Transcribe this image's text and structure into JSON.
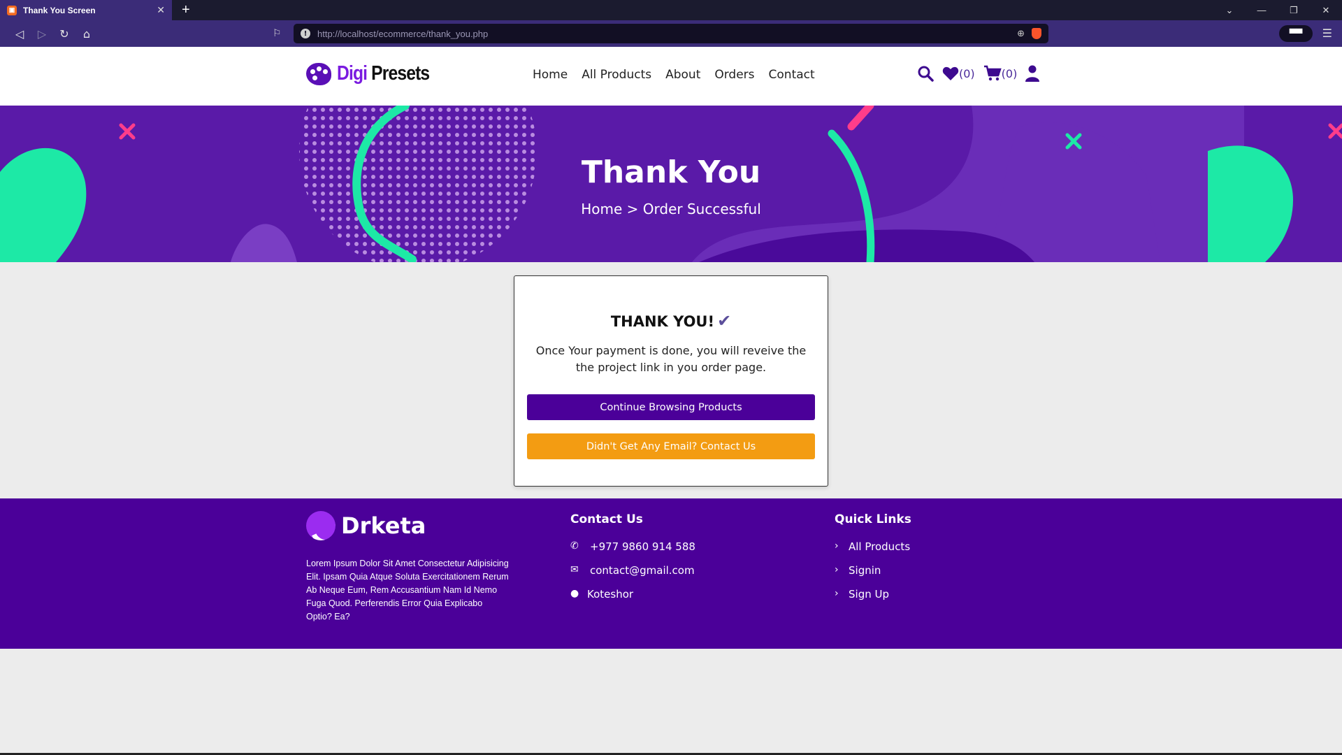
{
  "browser": {
    "tab_title": "Thank You Screen",
    "tab_close": "✕",
    "new_tab": "+",
    "url_host": "http://localhost/ecommerce/thank_you.php",
    "window_controls": [
      "⌄",
      "—",
      "❐",
      "✕"
    ]
  },
  "header": {
    "brand_part1": "Digi",
    "brand_part2": "Presets",
    "nav": [
      "Home",
      "All Products",
      "About",
      "Orders",
      "Contact"
    ],
    "wishlist_count": "(0)",
    "cart_count": "(0)"
  },
  "banner": {
    "title": "Thank You",
    "breadcrumb": "Home > Order Successful"
  },
  "card": {
    "title": "THANK YOU!",
    "check": "✔",
    "message": "Once Your payment is done, you will reveive the the project link in you order page.",
    "primary_button": "Continue Browsing Products",
    "secondary_button": "Didn't Get Any Email? Contact Us"
  },
  "footer": {
    "brand": "Drketa",
    "about": "Lorem Ipsum Dolor Sit Amet Consectetur Adipisicing Elit. Ipsam Quia Atque Soluta Exercitationem Rerum Ab Neque Eum, Rem Accusantium Nam Id Nemo Fuga Quod. Perferendis Error Quia Explicabo Optio? Ea?",
    "contact_title": "Contact Us",
    "phone": "+977 9860 914 588",
    "email": "contact@gmail.com",
    "location": "Koteshor",
    "links_title": "Quick Links",
    "links": [
      "All Products",
      "Signin",
      "Sign Up"
    ]
  },
  "colors": {
    "primary": "#4b0099",
    "banner": "#5a1aa8",
    "warning": "#f39c12",
    "accent_green": "#1de9a6",
    "accent_pink": "#ff3d8a"
  }
}
